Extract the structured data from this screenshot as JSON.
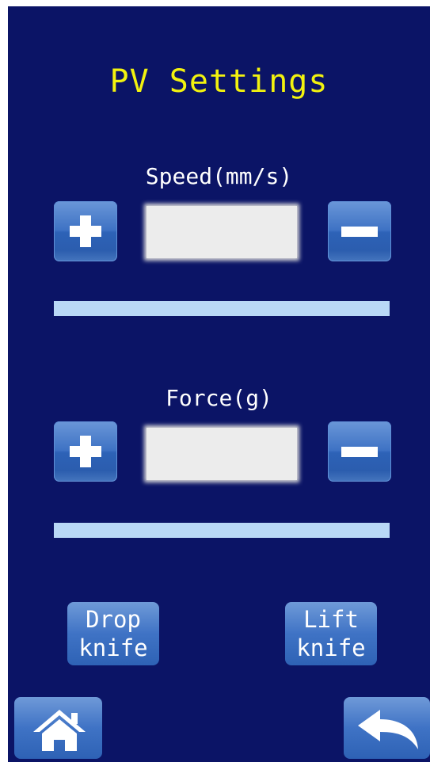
{
  "title": "PV Settings",
  "speed": {
    "label": "Speed(mm/s)",
    "value": ""
  },
  "force": {
    "label": "Force(g)",
    "value": ""
  },
  "knife": {
    "drop_line1": "Drop",
    "drop_line2": "knife",
    "lift_line1": "Lift",
    "lift_line2": "knife"
  },
  "icons": {
    "increase": "plus-icon",
    "decrease": "minus-icon",
    "home": "home-icon",
    "back": "back-arrow-icon"
  },
  "colors": {
    "background": "#0b1466",
    "title": "#f2f20f",
    "button": "#3e72c4",
    "slider": "#b9d8f6",
    "input": "#ececec"
  }
}
